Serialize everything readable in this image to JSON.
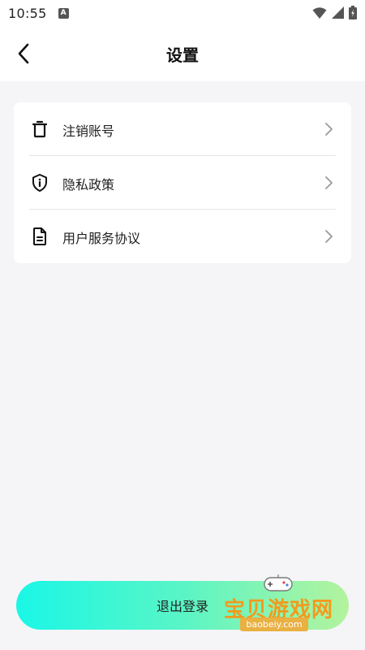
{
  "status_bar": {
    "time": "10:55",
    "notification_letter": "A"
  },
  "header": {
    "title": "设置",
    "back_icon": "chevron-left-icon"
  },
  "menu": {
    "items": [
      {
        "label": "注销账号",
        "icon": "trash-icon"
      },
      {
        "label": "隐私政策",
        "icon": "shield-info-icon"
      },
      {
        "label": "用户服务协议",
        "icon": "document-icon"
      }
    ]
  },
  "logout": {
    "label": "退出登录",
    "gradient": [
      "#1af7e6",
      "#b4f39d"
    ]
  },
  "watermark": {
    "title": "宝贝游戏网",
    "url": "baobeiy.com",
    "color": "#f29a1e"
  }
}
